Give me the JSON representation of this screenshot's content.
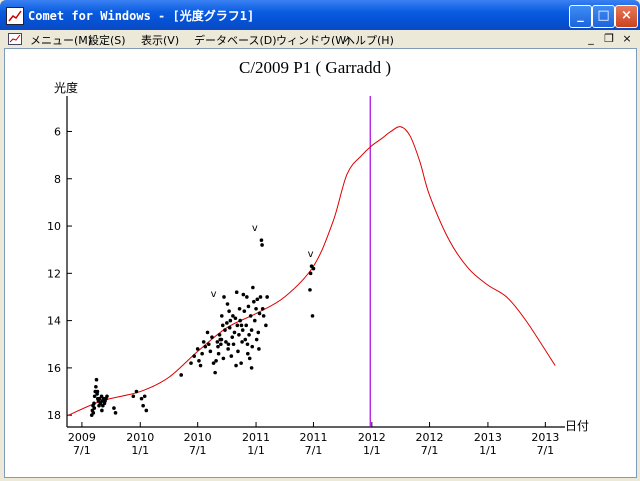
{
  "window": {
    "title": "Comet for Windows - [光度グラフ1]",
    "min_label": "_",
    "max_label": "□",
    "close_label": "×"
  },
  "menu": {
    "items": [
      "メニュー(M)",
      "設定(S)",
      "表示(V)",
      "データベース(D)",
      "ウィンドウ(W)",
      "ヘルプ(H)"
    ],
    "mdi_min": "_",
    "mdi_restore": "❐",
    "mdi_close": "×"
  },
  "chart_data": {
    "type": "scatter",
    "title": "C/2009 P1 ( Garradd )",
    "ylabel": "光度",
    "xlabel": "日付",
    "y_inverted": true,
    "ylim": [
      18.5,
      4.5
    ],
    "yticks": [
      "6",
      "8",
      "10",
      "12",
      "14",
      "16",
      "18"
    ],
    "xlim": [
      "2009-05-15",
      "2013-09-01"
    ],
    "xticks": [
      {
        "date": "2009-07-01",
        "year": "2009",
        "md": "7/1"
      },
      {
        "date": "2010-01-01",
        "year": "2010",
        "md": "1/1"
      },
      {
        "date": "2010-07-01",
        "year": "2010",
        "md": "7/1"
      },
      {
        "date": "2011-01-01",
        "year": "2011",
        "md": "1/1"
      },
      {
        "date": "2011-07-01",
        "year": "2011",
        "md": "7/1"
      },
      {
        "date": "2012-01-01",
        "year": "2012",
        "md": "1/1"
      },
      {
        "date": "2012-07-01",
        "year": "2012",
        "md": "7/1"
      },
      {
        "date": "2013-01-01",
        "year": "2013",
        "md": "1/1"
      },
      {
        "date": "2013-07-01",
        "year": "2013",
        "md": "7/1"
      }
    ],
    "current_date": "2011-12-27",
    "colors": {
      "curve": "#dd0000",
      "marker": "#aa00dd",
      "points": "#000000",
      "axis": "#000000"
    },
    "curve": {
      "x": [
        "2009-05-20",
        "2009-09-01",
        "2010-01-01",
        "2010-04-01",
        "2010-07-01",
        "2010-10-01",
        "2011-01-01",
        "2011-04-01",
        "2011-07-01",
        "2011-09-01",
        "2011-10-15",
        "2011-12-01",
        "2012-01-01",
        "2012-02-01",
        "2012-03-01",
        "2012-04-01",
        "2012-05-01",
        "2012-06-01",
        "2012-07-01",
        "2012-09-01",
        "2012-11-01",
        "2013-01-01",
        "2013-03-01",
        "2013-05-01",
        "2013-08-01"
      ],
      "y": [
        18.0,
        17.4,
        17.0,
        16.4,
        15.3,
        14.3,
        13.7,
        13.0,
        11.7,
        9.8,
        7.8,
        7.0,
        6.6,
        6.3,
        6.0,
        5.8,
        6.2,
        7.3,
        8.7,
        10.6,
        11.8,
        12.5,
        13.0,
        14.0,
        15.9
      ]
    },
    "points": {
      "x": [
        "2009-08-01",
        "2009-08-03",
        "2009-08-05",
        "2009-08-06",
        "2009-08-08",
        "2009-08-10",
        "2009-08-12",
        "2009-08-14",
        "2009-08-16",
        "2009-08-18",
        "2009-08-20",
        "2009-08-22",
        "2009-08-24",
        "2009-08-26",
        "2009-08-28",
        "2009-09-01",
        "2009-09-03",
        "2009-09-05",
        "2009-09-08",
        "2009-09-10",
        "2009-09-12",
        "2009-09-15",
        "2009-09-18",
        "2009-10-10",
        "2009-10-15",
        "2009-12-10",
        "2009-12-20",
        "2010-01-05",
        "2010-01-10",
        "2010-01-15",
        "2010-01-20",
        "2010-05-10",
        "2010-06-10",
        "2010-06-20",
        "2010-07-01",
        "2010-07-05",
        "2010-07-10",
        "2010-07-15",
        "2010-07-20",
        "2010-07-25",
        "2010-08-01",
        "2010-08-05",
        "2010-08-10",
        "2010-08-15",
        "2010-08-20",
        "2010-08-25",
        "2010-09-01",
        "2010-09-03",
        "2010-09-05",
        "2010-09-08",
        "2010-09-10",
        "2010-09-12",
        "2010-09-15",
        "2010-09-18",
        "2010-09-20",
        "2010-09-22",
        "2010-09-25",
        "2010-09-28",
        "2010-10-01",
        "2010-10-03",
        "2010-10-05",
        "2010-10-08",
        "2010-10-10",
        "2010-10-12",
        "2010-10-15",
        "2010-10-18",
        "2010-10-20",
        "2010-10-22",
        "2010-10-25",
        "2010-10-28",
        "2010-11-01",
        "2010-11-03",
        "2010-11-05",
        "2010-11-08",
        "2010-11-10",
        "2010-11-12",
        "2010-11-15",
        "2010-11-18",
        "2010-11-20",
        "2010-11-22",
        "2010-11-25",
        "2010-11-28",
        "2010-12-01",
        "2010-12-03",
        "2010-12-05",
        "2010-12-08",
        "2010-12-10",
        "2010-12-12",
        "2010-12-15",
        "2010-12-18",
        "2010-12-20",
        "2010-12-22",
        "2010-12-25",
        "2010-12-28",
        "2011-01-01",
        "2011-01-03",
        "2011-01-05",
        "2011-01-08",
        "2011-01-10",
        "2011-01-12",
        "2011-01-15",
        "2011-01-18",
        "2011-01-20",
        "2011-01-25",
        "2011-02-01",
        "2011-02-05",
        "2011-06-20",
        "2011-06-22",
        "2011-06-25",
        "2011-06-28",
        "2011-07-01",
        "2009-08-09",
        "2009-08-19",
        "2009-09-02",
        "2010-10-06",
        "2010-11-16",
        "2010-12-06",
        "2010-08-28",
        "2010-09-14",
        "2011-01-22",
        "2010-12-18",
        "2010-10-30"
      ],
      "y": [
        18.0,
        17.8,
        17.6,
        17.9,
        17.5,
        17.2,
        17.0,
        16.8,
        16.5,
        17.1,
        17.3,
        17.4,
        17.6,
        17.3,
        17.5,
        17.2,
        17.4,
        17.6,
        17.3,
        17.5,
        17.4,
        17.3,
        17.2,
        17.7,
        17.9,
        17.2,
        17.0,
        17.3,
        17.6,
        17.2,
        17.8,
        16.3,
        15.8,
        15.5,
        15.2,
        15.7,
        15.9,
        15.4,
        14.9,
        15.1,
        14.5,
        15.0,
        15.3,
        14.7,
        15.8,
        16.2,
        14.9,
        15.1,
        15.4,
        14.6,
        14.8,
        15.0,
        13.8,
        14.2,
        15.6,
        13.0,
        14.4,
        14.9,
        14.1,
        13.3,
        15.2,
        13.6,
        14.3,
        14.0,
        15.5,
        14.7,
        13.8,
        15.0,
        14.5,
        13.9,
        12.8,
        14.2,
        15.3,
        14.6,
        13.5,
        14.0,
        15.8,
        14.9,
        14.4,
        12.9,
        13.6,
        14.8,
        14.2,
        13.0,
        15.0,
        13.4,
        14.6,
        15.6,
        13.8,
        14.4,
        15.1,
        12.6,
        13.2,
        14.0,
        13.5,
        14.8,
        13.1,
        14.5,
        15.2,
        13.7,
        13.0,
        10.6,
        10.8,
        13.8,
        14.2,
        13.0,
        12.7,
        12.0,
        11.7,
        13.8,
        11.8,
        17.7,
        17.0,
        17.8,
        15.0,
        14.2,
        15.4,
        15.7,
        14.8,
        13.5,
        16.0,
        15.9
      ],
      "labels": [
        {
          "date": "2010-12-28",
          "mag": 10.2,
          "text": "v"
        },
        {
          "date": "2010-08-20",
          "mag": 13.0,
          "text": "v"
        },
        {
          "date": "2011-06-22",
          "mag": 11.3,
          "text": "v"
        }
      ]
    }
  }
}
